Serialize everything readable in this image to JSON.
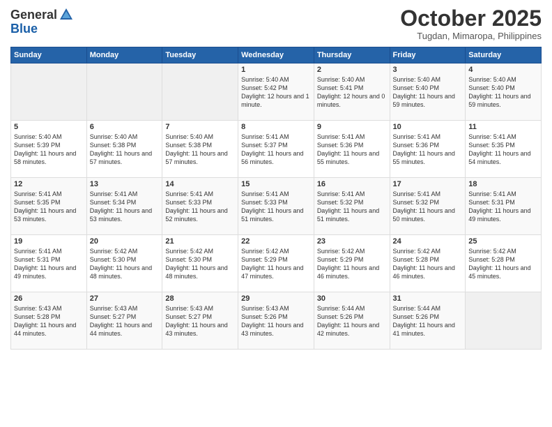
{
  "header": {
    "logo_general": "General",
    "logo_blue": "Blue",
    "month": "October 2025",
    "location": "Tugdan, Mimaropa, Philippines"
  },
  "weekdays": [
    "Sunday",
    "Monday",
    "Tuesday",
    "Wednesday",
    "Thursday",
    "Friday",
    "Saturday"
  ],
  "weeks": [
    [
      {
        "day": "",
        "sunrise": "",
        "sunset": "",
        "daylight": "",
        "empty": true
      },
      {
        "day": "",
        "sunrise": "",
        "sunset": "",
        "daylight": "",
        "empty": true
      },
      {
        "day": "",
        "sunrise": "",
        "sunset": "",
        "daylight": "",
        "empty": true
      },
      {
        "day": "1",
        "sunrise": "Sunrise: 5:40 AM",
        "sunset": "Sunset: 5:42 PM",
        "daylight": "Daylight: 12 hours and 1 minute."
      },
      {
        "day": "2",
        "sunrise": "Sunrise: 5:40 AM",
        "sunset": "Sunset: 5:41 PM",
        "daylight": "Daylight: 12 hours and 0 minutes."
      },
      {
        "day": "3",
        "sunrise": "Sunrise: 5:40 AM",
        "sunset": "Sunset: 5:40 PM",
        "daylight": "Daylight: 11 hours and 59 minutes."
      },
      {
        "day": "4",
        "sunrise": "Sunrise: 5:40 AM",
        "sunset": "Sunset: 5:40 PM",
        "daylight": "Daylight: 11 hours and 59 minutes."
      }
    ],
    [
      {
        "day": "5",
        "sunrise": "Sunrise: 5:40 AM",
        "sunset": "Sunset: 5:39 PM",
        "daylight": "Daylight: 11 hours and 58 minutes."
      },
      {
        "day": "6",
        "sunrise": "Sunrise: 5:40 AM",
        "sunset": "Sunset: 5:38 PM",
        "daylight": "Daylight: 11 hours and 57 minutes."
      },
      {
        "day": "7",
        "sunrise": "Sunrise: 5:40 AM",
        "sunset": "Sunset: 5:38 PM",
        "daylight": "Daylight: 11 hours and 57 minutes."
      },
      {
        "day": "8",
        "sunrise": "Sunrise: 5:41 AM",
        "sunset": "Sunset: 5:37 PM",
        "daylight": "Daylight: 11 hours and 56 minutes."
      },
      {
        "day": "9",
        "sunrise": "Sunrise: 5:41 AM",
        "sunset": "Sunset: 5:36 PM",
        "daylight": "Daylight: 11 hours and 55 minutes."
      },
      {
        "day": "10",
        "sunrise": "Sunrise: 5:41 AM",
        "sunset": "Sunset: 5:36 PM",
        "daylight": "Daylight: 11 hours and 55 minutes."
      },
      {
        "day": "11",
        "sunrise": "Sunrise: 5:41 AM",
        "sunset": "Sunset: 5:35 PM",
        "daylight": "Daylight: 11 hours and 54 minutes."
      }
    ],
    [
      {
        "day": "12",
        "sunrise": "Sunrise: 5:41 AM",
        "sunset": "Sunset: 5:35 PM",
        "daylight": "Daylight: 11 hours and 53 minutes."
      },
      {
        "day": "13",
        "sunrise": "Sunrise: 5:41 AM",
        "sunset": "Sunset: 5:34 PM",
        "daylight": "Daylight: 11 hours and 53 minutes."
      },
      {
        "day": "14",
        "sunrise": "Sunrise: 5:41 AM",
        "sunset": "Sunset: 5:33 PM",
        "daylight": "Daylight: 11 hours and 52 minutes."
      },
      {
        "day": "15",
        "sunrise": "Sunrise: 5:41 AM",
        "sunset": "Sunset: 5:33 PM",
        "daylight": "Daylight: 11 hours and 51 minutes."
      },
      {
        "day": "16",
        "sunrise": "Sunrise: 5:41 AM",
        "sunset": "Sunset: 5:32 PM",
        "daylight": "Daylight: 11 hours and 51 minutes."
      },
      {
        "day": "17",
        "sunrise": "Sunrise: 5:41 AM",
        "sunset": "Sunset: 5:32 PM",
        "daylight": "Daylight: 11 hours and 50 minutes."
      },
      {
        "day": "18",
        "sunrise": "Sunrise: 5:41 AM",
        "sunset": "Sunset: 5:31 PM",
        "daylight": "Daylight: 11 hours and 49 minutes."
      }
    ],
    [
      {
        "day": "19",
        "sunrise": "Sunrise: 5:41 AM",
        "sunset": "Sunset: 5:31 PM",
        "daylight": "Daylight: 11 hours and 49 minutes."
      },
      {
        "day": "20",
        "sunrise": "Sunrise: 5:42 AM",
        "sunset": "Sunset: 5:30 PM",
        "daylight": "Daylight: 11 hours and 48 minutes."
      },
      {
        "day": "21",
        "sunrise": "Sunrise: 5:42 AM",
        "sunset": "Sunset: 5:30 PM",
        "daylight": "Daylight: 11 hours and 48 minutes."
      },
      {
        "day": "22",
        "sunrise": "Sunrise: 5:42 AM",
        "sunset": "Sunset: 5:29 PM",
        "daylight": "Daylight: 11 hours and 47 minutes."
      },
      {
        "day": "23",
        "sunrise": "Sunrise: 5:42 AM",
        "sunset": "Sunset: 5:29 PM",
        "daylight": "Daylight: 11 hours and 46 minutes."
      },
      {
        "day": "24",
        "sunrise": "Sunrise: 5:42 AM",
        "sunset": "Sunset: 5:28 PM",
        "daylight": "Daylight: 11 hours and 46 minutes."
      },
      {
        "day": "25",
        "sunrise": "Sunrise: 5:42 AM",
        "sunset": "Sunset: 5:28 PM",
        "daylight": "Daylight: 11 hours and 45 minutes."
      }
    ],
    [
      {
        "day": "26",
        "sunrise": "Sunrise: 5:43 AM",
        "sunset": "Sunset: 5:28 PM",
        "daylight": "Daylight: 11 hours and 44 minutes."
      },
      {
        "day": "27",
        "sunrise": "Sunrise: 5:43 AM",
        "sunset": "Sunset: 5:27 PM",
        "daylight": "Daylight: 11 hours and 44 minutes."
      },
      {
        "day": "28",
        "sunrise": "Sunrise: 5:43 AM",
        "sunset": "Sunset: 5:27 PM",
        "daylight": "Daylight: 11 hours and 43 minutes."
      },
      {
        "day": "29",
        "sunrise": "Sunrise: 5:43 AM",
        "sunset": "Sunset: 5:26 PM",
        "daylight": "Daylight: 11 hours and 43 minutes."
      },
      {
        "day": "30",
        "sunrise": "Sunrise: 5:44 AM",
        "sunset": "Sunset: 5:26 PM",
        "daylight": "Daylight: 11 hours and 42 minutes."
      },
      {
        "day": "31",
        "sunrise": "Sunrise: 5:44 AM",
        "sunset": "Sunset: 5:26 PM",
        "daylight": "Daylight: 11 hours and 41 minutes."
      },
      {
        "day": "",
        "sunrise": "",
        "sunset": "",
        "daylight": "",
        "empty": true
      }
    ]
  ]
}
